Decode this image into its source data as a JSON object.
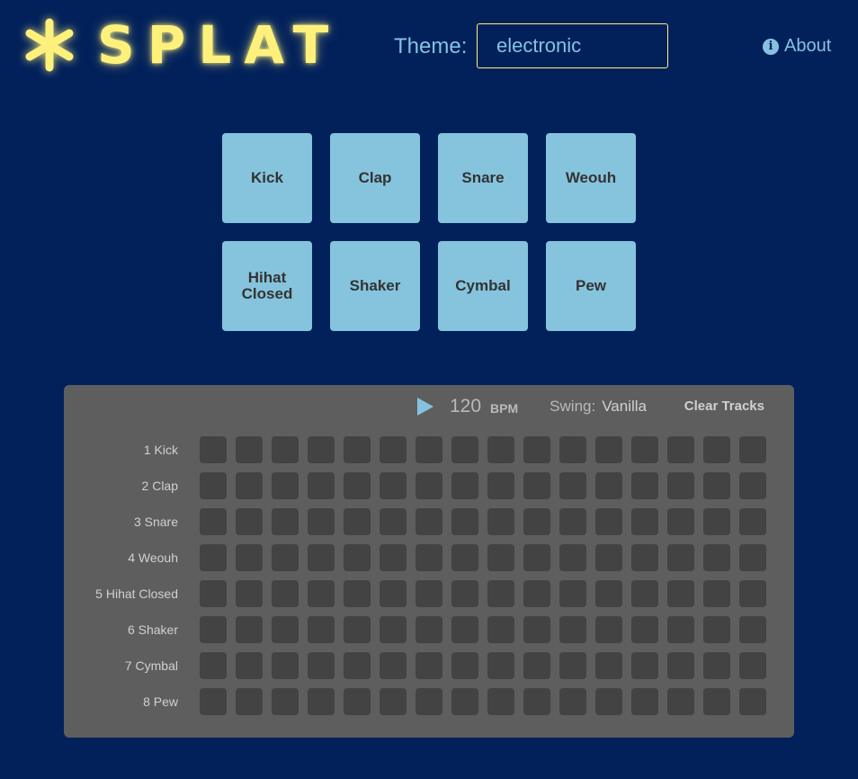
{
  "app": {
    "logo_text": "SPLAT"
  },
  "theme": {
    "label": "Theme:",
    "value": "electronic"
  },
  "about": {
    "label": "About"
  },
  "pads": [
    "Kick",
    "Clap",
    "Snare",
    "Weouh",
    "Hihat Closed",
    "Shaker",
    "Cymbal",
    "Pew"
  ],
  "sequencer": {
    "bpm": "120",
    "bpm_label": "BPM",
    "swing_label": "Swing:",
    "swing_value": "Vanilla",
    "clear_label": "Clear Tracks",
    "steps_per_track": 16,
    "tracks": [
      "1 Kick",
      "2 Clap",
      "3 Snare",
      "4 Weouh",
      "5 Hihat Closed",
      "6 Shaker",
      "7 Cymbal",
      "8 Pew"
    ]
  },
  "colors": {
    "background": "#02215b",
    "accent_yellow": "#fdf17c",
    "accent_blue": "#86c2e0",
    "pad": "#86c4dd",
    "panel": "#5e5e5e",
    "step_off": "#434343"
  }
}
